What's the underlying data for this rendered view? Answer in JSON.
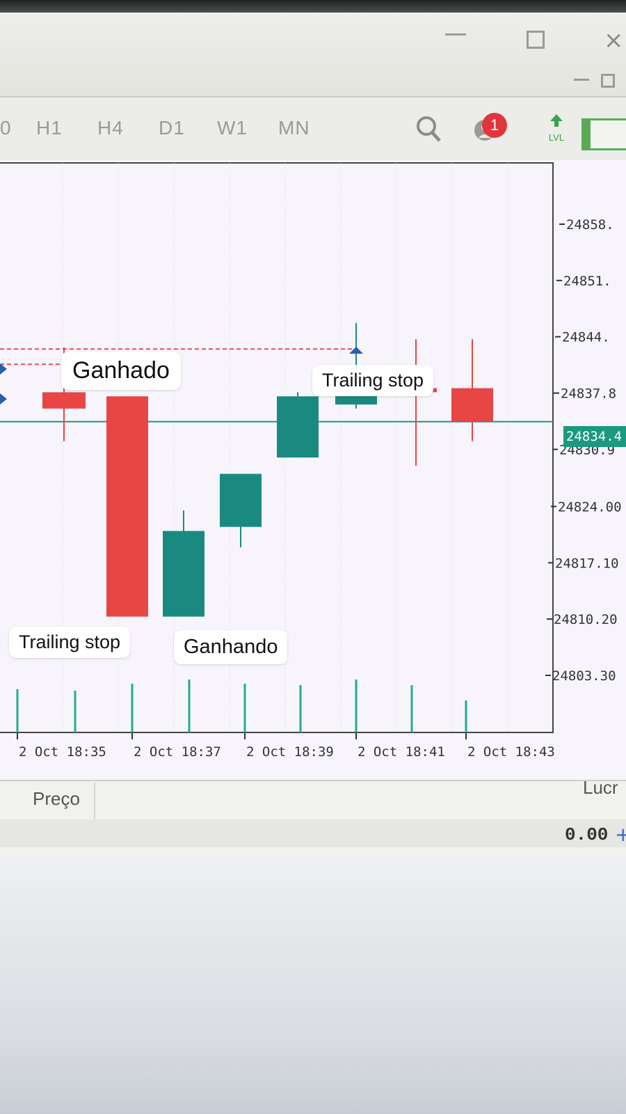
{
  "toolbar": {
    "timeframes": [
      "0",
      "H1",
      "H4",
      "D1",
      "W1",
      "MN"
    ],
    "notification_count": "1",
    "lvl_label": "LVL"
  },
  "chart": {
    "price_ticks": [
      "24858.",
      "24851.",
      "24844.",
      "24837.8",
      "24830.9",
      "24824.00",
      "24817.10",
      "24810.20",
      "24803.30"
    ],
    "current_price": "24834.4",
    "time_ticks": [
      "2 Oct 18:35",
      "2 Oct 18:37",
      "2 Oct 18:39",
      "2 Oct 18:41",
      "2 Oct 18:43"
    ]
  },
  "chart_data": {
    "type": "candlestick",
    "xlabel": "",
    "ylabel": "",
    "bull_color": "#1a8a80",
    "bear_color": "#e84545",
    "candles": [
      {
        "time": "2 Oct 18:35",
        "open": 24838.0,
        "high": 24843.5,
        "low": 24832.0,
        "close": 24836.0
      },
      {
        "time": "2 Oct 18:36",
        "open": 24837.5,
        "high": 24837.5,
        "low": 24810.5,
        "close": 24810.5
      },
      {
        "time": "2 Oct 18:37",
        "open": 24810.5,
        "high": 24823.5,
        "low": 24810.5,
        "close": 24821.0
      },
      {
        "time": "2 Oct 18:38",
        "open": 24821.5,
        "high": 24826.5,
        "low": 24819.0,
        "close": 24828.0
      },
      {
        "time": "2 Oct 18:39",
        "open": 24830.0,
        "high": 24838.0,
        "low": 24830.0,
        "close": 24837.5
      },
      {
        "time": "2 Oct 18:40",
        "open": 24836.5,
        "high": 24846.5,
        "low": 24836.0,
        "close": 24839.0
      },
      {
        "time": "2 Oct 18:41",
        "open": 24838.5,
        "high": 24844.5,
        "low": 24829.0,
        "close": 24838.0
      },
      {
        "time": "2 Oct 18:42",
        "open": 24838.5,
        "high": 24844.5,
        "low": 24832.0,
        "close": 24834.4
      }
    ],
    "volume_ticks_count": 9
  },
  "annotations": {
    "ganhado": "Ganhado",
    "trailing_stop_1": "Trailing stop",
    "trailing_stop_2": "Trailing stop",
    "ganhando": "Ganhando"
  },
  "positions_panel": {
    "price_header": "Preço",
    "profit_header": "Lucr",
    "profit_value": "0.00"
  },
  "colors": {
    "accent": "#1a9a7e",
    "badge": "#e0353b"
  }
}
